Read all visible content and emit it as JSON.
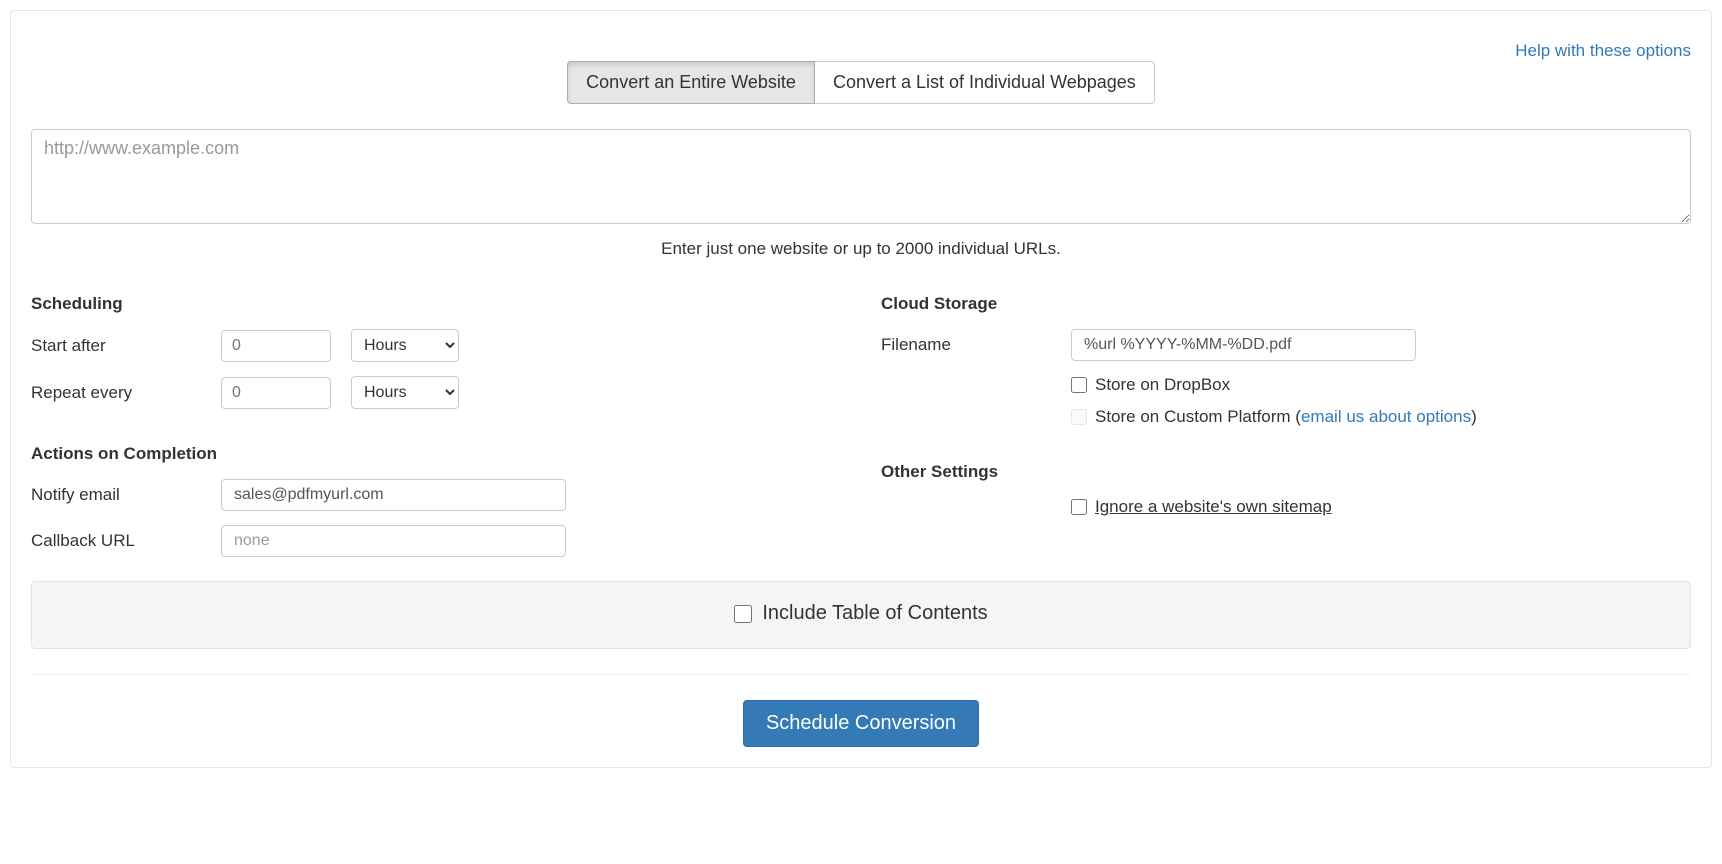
{
  "help_link": "Help with these options",
  "tabs": {
    "entire": "Convert an Entire Website",
    "list": "Convert a List of Individual Webpages"
  },
  "url_input": {
    "placeholder": "http://www.example.com",
    "helper": "Enter just one website or up to 2000 individual URLs."
  },
  "scheduling": {
    "header": "Scheduling",
    "start_after": {
      "label": "Start after",
      "value": "0",
      "unit": "Hours"
    },
    "repeat_every": {
      "label": "Repeat every",
      "value": "0",
      "unit": "Hours"
    }
  },
  "actions": {
    "header": "Actions on Completion",
    "notify_email": {
      "label": "Notify email",
      "value": "sales@pdfmyurl.com"
    },
    "callback_url": {
      "label": "Callback URL",
      "placeholder": "none"
    }
  },
  "cloud": {
    "header": "Cloud Storage",
    "filename": {
      "label": "Filename",
      "value": "%url %YYYY-%MM-%DD.pdf"
    },
    "dropbox": "Store on DropBox",
    "custom": {
      "prefix": "Store on Custom Platform (",
      "link": "email us about options",
      "suffix": ")"
    }
  },
  "other": {
    "header": "Other Settings",
    "ignore_sitemap": "Ignore a website's own sitemap"
  },
  "toc": {
    "label": "Include Table of Contents"
  },
  "submit": "Schedule Conversion"
}
